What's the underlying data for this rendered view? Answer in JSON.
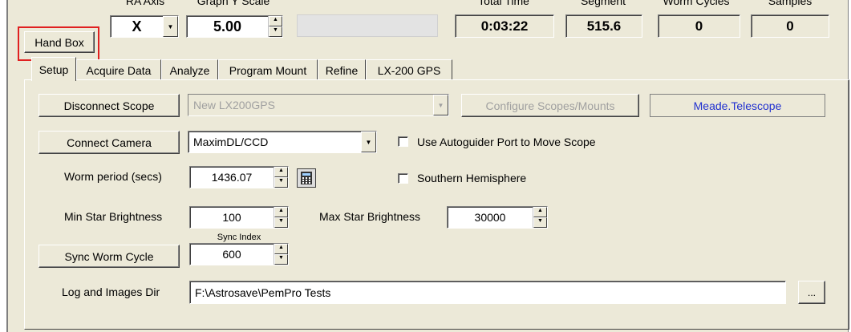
{
  "top": {
    "ra_axis_label": "RA Axis",
    "graph_scale_label": "Graph Y Scale",
    "total_time_label": "Total Time",
    "segment_label": "Segment",
    "worm_cycles_label": "Worm Cycles",
    "samples_label": "Samples",
    "hand_box_label": "Hand Box",
    "axis_value": "X",
    "scale_value": "5.00",
    "total_time": "0:03:22",
    "segment": "515.6",
    "worm_cycles": "0",
    "samples": "0"
  },
  "tabs": [
    "Setup",
    "Acquire Data",
    "Analyze",
    "Program Mount",
    "Refine",
    "LX-200 GPS"
  ],
  "setup": {
    "disconnect_scope": "Disconnect Scope",
    "scope_select": "New LX200GPS",
    "configure_scopes": "Configure Scopes/Mounts",
    "driver_name": "Meade.Telescope",
    "connect_camera": "Connect Camera",
    "camera_select": "MaximDL/CCD",
    "use_autoguider_label": "Use Autoguider Port to Move Scope",
    "worm_period_label": "Worm period (secs)",
    "worm_period_value": "1436.07",
    "southern_label": "Southern Hemisphere",
    "min_star_label": "Min Star Brightness",
    "min_star_value": "100",
    "max_star_label": "Max Star Brightness",
    "max_star_value": "30000",
    "sync_index_label": "Sync Index",
    "sync_worm_cycle": "Sync Worm Cycle",
    "sync_index_value": "600",
    "log_dir_label": "Log and Images Dir",
    "log_dir_value": "F:\\Astrosave\\PemPro Tests",
    "browse_label": "..."
  },
  "colors": {
    "driver_text": "#2030d0",
    "highlight": "#e02020"
  }
}
